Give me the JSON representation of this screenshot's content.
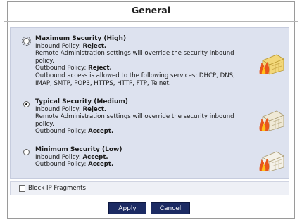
{
  "title": "General",
  "options": [
    {
      "title": "Maximum Security (High)",
      "inbound_label": "Inbound Policy: ",
      "inbound_value": "Reject.",
      "note": "Remote Administration settings will override the security inbound policy.",
      "outbound_label": "Outbound Policy: ",
      "outbound_value": "Reject.",
      "services": "Outbound access is allowed to the following services: DHCP, DNS, IMAP, SMTP, POP3, HTTPS, HTTP, FTP, Telnet.",
      "checked": false,
      "icon": "firewall-fire-icon"
    },
    {
      "title": "Typical Security (Medium)",
      "inbound_label": "Inbound Policy: ",
      "inbound_value": "Reject.",
      "note": "Remote Administration settings will override the security inbound policy.",
      "outbound_label": "Outbound Policy: ",
      "outbound_value": "Accept.",
      "checked": true,
      "icon": "firewall-fire-icon"
    },
    {
      "title": "Minimum Security (Low)",
      "inbound_label": "Inbound Policy: ",
      "inbound_value": "Accept.",
      "outbound_label": "Outbound Policy: ",
      "outbound_value": "Accept.",
      "checked": false,
      "icon": "firewall-fire-icon"
    }
  ],
  "block_ip_fragments": {
    "label": "Block IP Fragments",
    "checked": false
  },
  "buttons": {
    "apply": "Apply",
    "cancel": "Cancel"
  },
  "colors": {
    "panel": "#dde2ef",
    "button": "#1c2b63"
  }
}
